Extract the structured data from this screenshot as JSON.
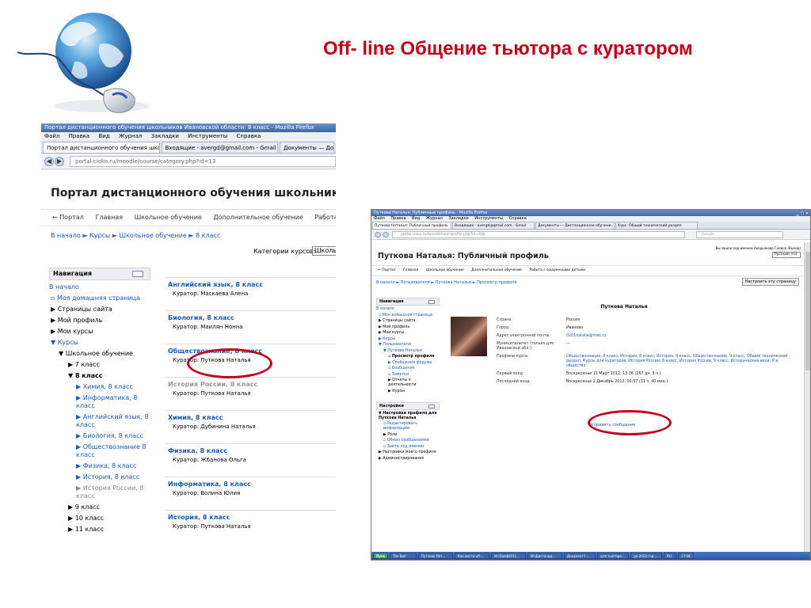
{
  "slide_title": "Off- line Общение тьютора с куратором",
  "colors": {
    "title": "#c0001a",
    "link": "#1a5bb4",
    "annotation": "#c0001a"
  },
  "left": {
    "window_title": "Портал дистанционного обучения школьников Ивановской области: 8 класс - Mozilla Firefox",
    "menu": [
      "Файл",
      "Правка",
      "Вид",
      "Журнал",
      "Закладки",
      "Инструменты",
      "Справка"
    ],
    "tabs": [
      "Портал дистанционного обучения шко...",
      "Входящие - avergd@gmail.com - Gmail",
      "Документы — До"
    ],
    "url": "portal.cioko.ru/moodle/course/category.php?id=13",
    "site_title": "Портал дистанционного обучения школьников Ивановс",
    "nav": [
      "← Портал",
      "Главная",
      "Школьное обучение",
      "Дополнительное обучение",
      "Работа с одарен"
    ],
    "breadcrumb": "В начало ► Курсы ► Школьное обучение ► 8 класс",
    "nav_block_title": "Навигация",
    "tree": [
      "В начало",
      "Моя домашняя страница",
      "Страницы сайта",
      "Мой профиль",
      "Мои курсы",
      "Курсы",
      "Школьное обучение",
      "7 класс",
      "8 класс",
      "Химия, 8 класс",
      "Информатика, 8 класс",
      "Английский язык, 8 класс",
      "Биология, 8 класс",
      "Обществознание 8 класс",
      "Физика, 8 класс",
      "История, 8 класс",
      "История России, 8 класс",
      "9 класс",
      "10 класс",
      "11 класс"
    ],
    "category_label": "Категории курсов:",
    "category_value": "Школь",
    "courses": [
      {
        "name": "Английский язык, 8 класс",
        "curator": "Куратор: Маскаева Алена"
      },
      {
        "name": "Биология, 8 класс",
        "curator": "Куратор: Маилян Нонна"
      },
      {
        "name": "Обществознание, 8 класс",
        "curator": "Куратор: Путкова Наталья"
      },
      {
        "name": "История России, 8 класс",
        "curator": "Куратор: Путкова Наталья"
      },
      {
        "name": "Химия, 8 класс",
        "curator": "Куратор: Дубинина Наталья"
      },
      {
        "name": "Физика, 8 класс",
        "curator": "Куратор: Жбанова Ольга"
      },
      {
        "name": "Информатика, 8 класс",
        "curator": "Куратор: Волина Юлия"
      },
      {
        "name": "История, 8 класс",
        "curator": "Куратор: Путкова Наталья"
      }
    ]
  },
  "right": {
    "window_title": "Путкова Наталья: Публичный профиль - Mozilla Firefox",
    "menu": [
      "Файл",
      "Правка",
      "Вид",
      "Журнал",
      "Закладки",
      "Инструменты",
      "Справка"
    ],
    "tabs": [
      "Путкова Наталья: Публичный профиль",
      "Входящие - avergd@gmail.com - Gmail",
      "Документы — Дистанционное обучени...",
      "Курс: Общий технический раздел"
    ],
    "url": "portal.cioko.ru/moodle/user/profile.php?id=490",
    "search_placeholder": "Google",
    "page_title": "Путкова Наталья: Публичный профиль",
    "login_info": "Вы зашли под именем Аверьянова Галина (Выход)",
    "lang": "Русский (ru)",
    "nav": [
      "← Портал",
      "Главная",
      "Школьное обучение",
      "Дополнительное обучение",
      "Работа с одаренными детьми"
    ],
    "breadcrumb": "В начало ► Пользователи ► Путкова Наталья ► Просмотр профиля",
    "customize_button": "Настроить эту страницу",
    "nav_block_title": "Навигация",
    "tree": [
      "В начало",
      "Моя домашняя страница",
      "Страницы сайта",
      "Мой профиль",
      "Мои курсы",
      "Курсы",
      "Пользователи",
      "Путкова Наталья",
      "Просмотр профиля",
      "Сообщения форума",
      "Сообщения",
      "Заметки",
      "Отчеты о деятельности",
      "Курсы"
    ],
    "settings_block_title": "Настройки",
    "settings_tree": [
      "Настройки профиля для Путкова Наталья",
      "Редактировать информацию",
      "Роли",
      "Обмен сообщениями",
      "Зайти под именем",
      "Настройки моего профиля",
      "Администрирование"
    ],
    "profile_name": "Путкова Наталья",
    "fields": [
      {
        "label": "Страна:",
        "value": "Россия"
      },
      {
        "label": "Город:",
        "value": "Иваново"
      },
      {
        "label": "Адрес электронной почты:",
        "value": "0201natalia@mail.ru"
      },
      {
        "label": "Муниципалитет (только для Ивановской обл.):",
        "value": "---"
      },
      {
        "label": "Профили курса:",
        "value": "Обществознание, 8 класс, История, 8 класс, История, 9 класс, Обществознание, 9 класс, Общий технический раздел, Курсы для кураторов, История России, 8 класс, История России, 9 класс, Исторические вехи, Я и общество"
      },
      {
        "label": "Первый вход:",
        "value": "Воскресенье 11 Март 2012, 13:36  (267 дн. 9 ч.)"
      },
      {
        "label": "Последний вход:",
        "value": "Воскресенье 2 Декабрь 2012, 00:57  (31 ч. 40 мин.)"
      }
    ],
    "send_message": "Отправить сообщение",
    "taskbar": [
      "Пуск",
      "The Bat!",
      "Путкова Нат...",
      "Как мести off-...",
      "W:\\Проф2011...",
      "W:\\Дистанци...",
      "Документ1 -...",
      "для тьютора...",
      "дк-2013 год ...",
      "RU",
      "17:08"
    ]
  }
}
